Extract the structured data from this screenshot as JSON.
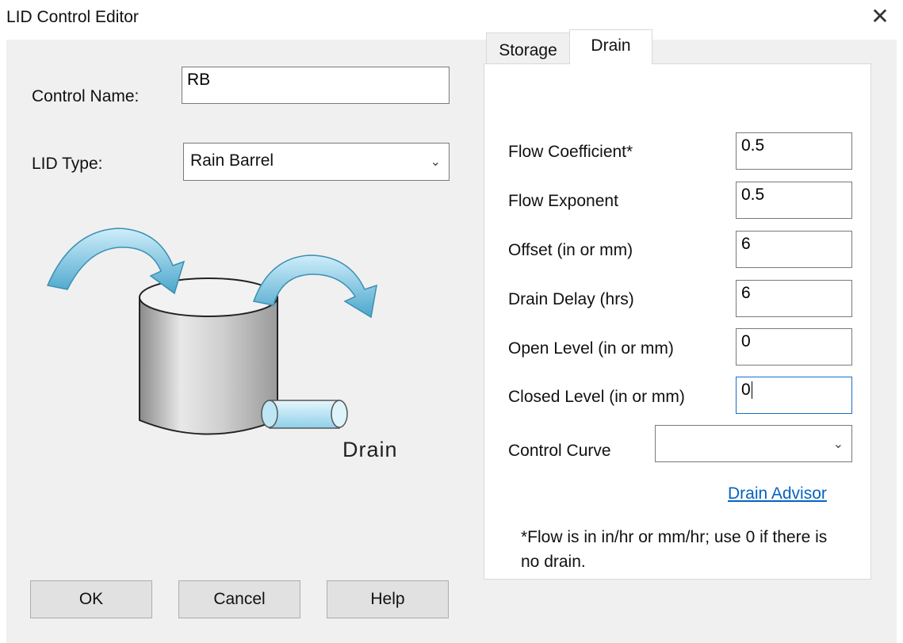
{
  "window": {
    "title": "LID Control Editor",
    "close_glyph": "✕"
  },
  "form": {
    "control_name_label": "Control Name:",
    "control_name_value": "RB",
    "lid_type_label": "LID Type:",
    "lid_type_value": "Rain Barrel"
  },
  "illustration": {
    "caption": "Drain"
  },
  "tabs": [
    {
      "label": "Storage",
      "active": false
    },
    {
      "label": "Drain",
      "active": true
    }
  ],
  "drain": {
    "fields": [
      {
        "label": "Flow Coefficient*",
        "value": "0.5"
      },
      {
        "label": "Flow Exponent",
        "value": "0.5"
      },
      {
        "label": "Offset (in or mm)",
        "value": "6"
      },
      {
        "label": "Drain Delay (hrs)",
        "value": "6"
      },
      {
        "label": "Open Level (in or mm)",
        "value": "0"
      },
      {
        "label": "Closed Level (in or mm)",
        "value": "0"
      }
    ],
    "control_curve_label": "Control Curve",
    "control_curve_value": "",
    "advisor_link": "Drain Advisor",
    "footnote": "*Flow is in in/hr or mm/hr; use 0 if there is no drain."
  },
  "buttons": {
    "ok": "OK",
    "cancel": "Cancel",
    "help": "Help"
  },
  "colors": {
    "link": "#0563c1",
    "focus_border": "#1a6fc4",
    "arrow_fill": "#5ab4d6",
    "pipe_fill": "#a8dcef"
  }
}
